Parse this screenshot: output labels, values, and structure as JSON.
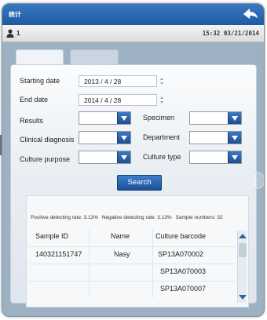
{
  "window": {
    "title": "统计",
    "accent_color": "#2763ab",
    "back_icon": "back-arrow-icon"
  },
  "status": {
    "user_icon": "user-icon",
    "user_count": "1",
    "time_date": "15:32 03/21/2014"
  },
  "tabs": [
    {
      "label": ""
    },
    {
      "label": ""
    }
  ],
  "form": {
    "starting_date": {
      "label": "Starting date",
      "value": "2013 / 4 / 28"
    },
    "end_date": {
      "label": "End date",
      "value": "2014 / 4 / 28"
    },
    "results": {
      "label": "Results",
      "value": ""
    },
    "specimen": {
      "label": "Specimen",
      "value": ""
    },
    "clinical_diagnosis": {
      "label": "Clinical diagnosis",
      "value": ""
    },
    "department": {
      "label": "Department",
      "value": ""
    },
    "culture_purpose": {
      "label": "Culture purpose",
      "value": ""
    },
    "culture_type": {
      "label": "Culture type",
      "value": ""
    },
    "search_label": "Search"
  },
  "summary": {
    "positive": "Positive detecting rate: 3.13%",
    "negative": "Negative detecting rate: 3.13%",
    "samples": "Sample numbers: 32"
  },
  "table": {
    "headers": [
      "Sample ID",
      "Name",
      "Culture barcode"
    ],
    "rows": [
      [
        "140321151747",
        "Nasy",
        "SP13A070002"
      ],
      [
        "",
        "",
        "SP13A070003"
      ],
      [
        "",
        "",
        "SP13A070007"
      ]
    ]
  }
}
